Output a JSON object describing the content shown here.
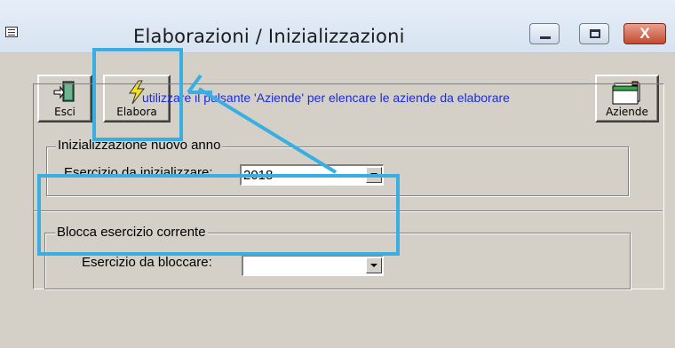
{
  "window": {
    "title": "Elaborazioni / Inizializzazioni",
    "controls": {
      "minimize": "",
      "maximize": "",
      "close": "X"
    }
  },
  "toolbar": {
    "esci_label": "Esci",
    "elabora_label": "Elabora",
    "aziende_label": "Aziende"
  },
  "hint_text": "utilizzare il pulsante 'Aziende' per elencare le aziende da elaborare",
  "group_new_year": {
    "legend": "Inizializzazione nuovo anno",
    "field_label": "Esercizio da inizializzare:",
    "value": "2018"
  },
  "group_block": {
    "legend": "Blocca esercizio corrente",
    "field_label": "Esercizio da bloccare:",
    "value": ""
  },
  "colors": {
    "annotation": "#39aee3",
    "hint": "#1a2be0",
    "window_bg": "#d4d0c8"
  }
}
